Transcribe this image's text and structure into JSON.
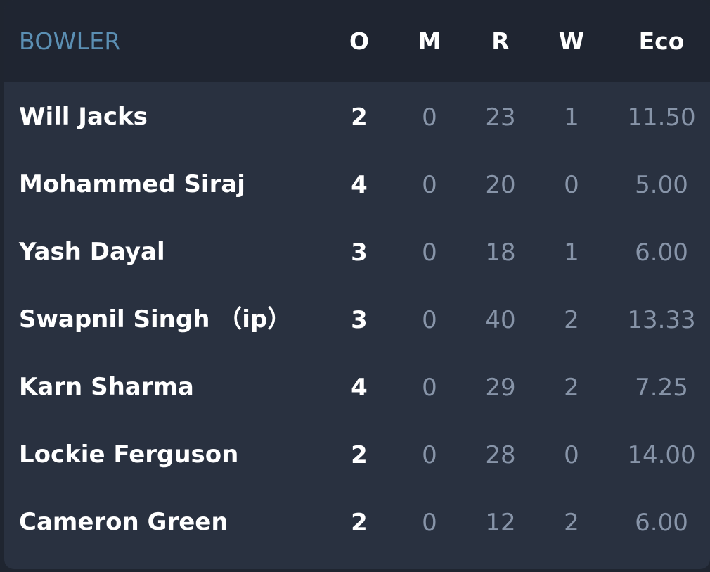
{
  "table": {
    "headers": {
      "bowler": "BOWLER",
      "overs": "O",
      "maidens": "M",
      "runs": "R",
      "wickets": "W",
      "economy": "Eco"
    },
    "rows": [
      {
        "bowler": "Will Jacks",
        "overs": "2",
        "maidens": "0",
        "runs": "23",
        "wickets": "1",
        "economy": "11.50"
      },
      {
        "bowler": "Mohammed Siraj",
        "overs": "4",
        "maidens": "0",
        "runs": "20",
        "wickets": "0",
        "economy": "5.00"
      },
      {
        "bowler": "Yash Dayal",
        "overs": "3",
        "maidens": "0",
        "runs": "18",
        "wickets": "1",
        "economy": "6.00"
      },
      {
        "bowler": "Swapnil Singh （ip）",
        "overs": "3",
        "maidens": "0",
        "runs": "40",
        "wickets": "2",
        "economy": "13.33"
      },
      {
        "bowler": "Karn Sharma",
        "overs": "4",
        "maidens": "0",
        "runs": "29",
        "wickets": "2",
        "economy": "7.25"
      },
      {
        "bowler": "Lockie Ferguson",
        "overs": "2",
        "maidens": "0",
        "runs": "28",
        "wickets": "0",
        "economy": "14.00"
      },
      {
        "bowler": "Cameron Green",
        "overs": "2",
        "maidens": "0",
        "runs": "12",
        "wickets": "2",
        "economy": "6.00"
      }
    ]
  },
  "colors": {
    "background": "#293140",
    "header_background": "#1f2531",
    "header_accent": "#5b8fb3",
    "primary_text": "#ffffff",
    "muted_text": "#8794a8"
  }
}
